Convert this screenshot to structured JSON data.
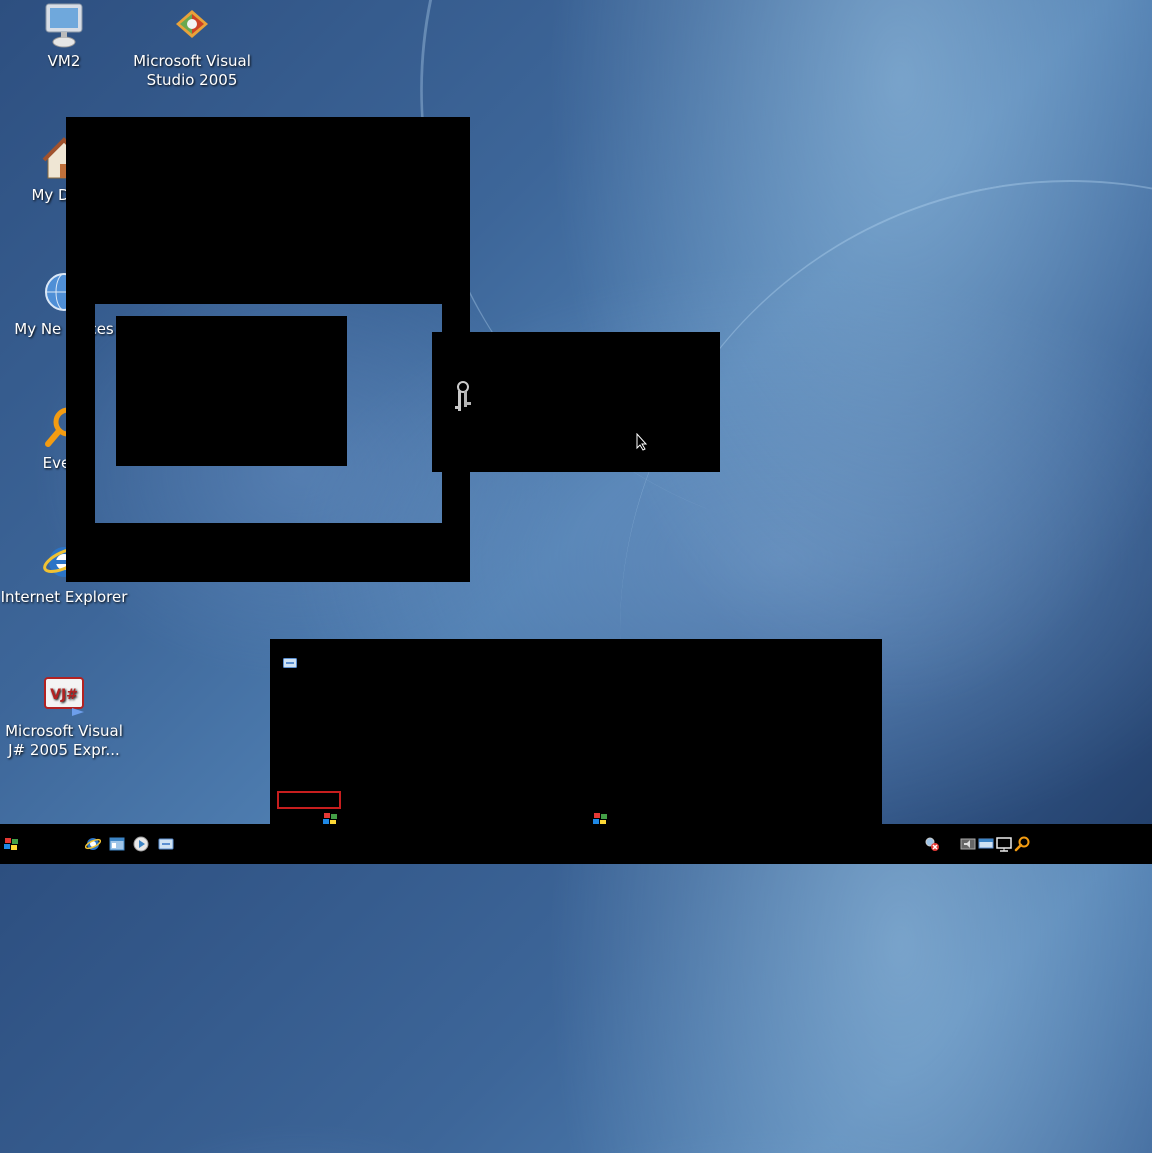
{
  "desktop": {
    "icons": [
      {
        "label": "VM2",
        "icon": "monitor-icon"
      },
      {
        "label": "Microsoft Visual Studio 2005",
        "icon": "visual-studio-icon"
      },
      {
        "label": "My Docu",
        "icon": "my-documents-icon"
      },
      {
        "label": "My Ne Places",
        "icon": "network-places-icon"
      },
      {
        "label": "Every",
        "icon": "search-icon"
      },
      {
        "label": "Internet Explorer",
        "icon": "internet-explorer-icon"
      },
      {
        "label": "Microsoft Visual J# 2005 Expr...",
        "icon": "visual-jsharp-icon"
      }
    ]
  },
  "taskbar": {
    "start_icon": "windows-logo-icon",
    "quick_launch": [
      "internet-explorer-icon",
      "explorer-icon",
      "media-player-icon",
      "keyboard-icon"
    ],
    "tray": [
      "network-icon",
      "volume-icon",
      "keyboard-icon",
      "display-icon",
      "search-icon"
    ]
  },
  "overlay": {
    "keys_icon": "keys-icon",
    "cursor_icon": "mouse-cursor-icon",
    "window_icon": "keyboard-icon"
  },
  "colors": {
    "highlight_box": "#c81e1e",
    "taskbar": "#000000"
  }
}
